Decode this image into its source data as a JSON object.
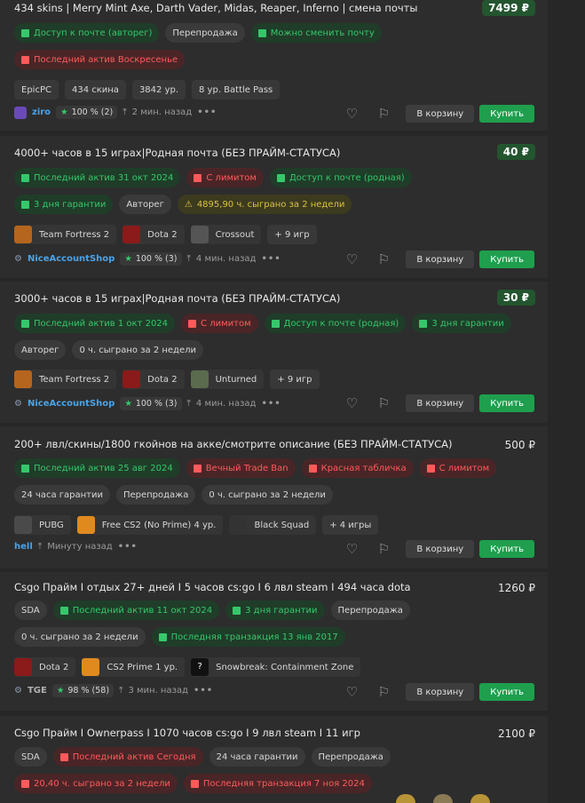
{
  "common": {
    "cart_label": "В корзину",
    "buy_label": "Купить",
    "heart_icon": "heart-icon",
    "flag_icon": "flag-icon"
  },
  "listings": [
    {
      "title": "434 skins | Merry Mint Axe, Darth Vader, Midas, Reaper, Inferno | смена почты",
      "price": "7499 ₽",
      "chips1": [
        {
          "text": "Доступ к почте (авторег)",
          "kind": "good"
        },
        {
          "text": "Перепродажа",
          "kind": "neutral"
        },
        {
          "text": "Можно сменить почту",
          "kind": "good"
        }
      ],
      "chips2": [
        {
          "text": "Последний актив Воскресенье",
          "kind": "bad"
        }
      ],
      "tags": [
        "EpicPC",
        "434 скина",
        "3842 ур.",
        "8 ур. Battle Pass"
      ],
      "seller": {
        "name": "ziro",
        "rating": "100 % (2)",
        "time": "2 мин. назад"
      }
    },
    {
      "title": "4000+ часов в 15 играх|Родная почта (БЕЗ ПРАЙМ-СТАТУСА)",
      "price": "40 ₽",
      "chips1": [
        {
          "text": "Последний актив 31 окт 2024",
          "kind": "good"
        },
        {
          "text": "С лимитом",
          "kind": "bad"
        },
        {
          "text": "Доступ к почте (родная)",
          "kind": "good"
        }
      ],
      "chips2": [
        {
          "text": "3 дня гарантии",
          "kind": "good"
        },
        {
          "text": "Авторег",
          "kind": "neutral"
        },
        {
          "text": "4895,90 ч. сыграно за 2 недели",
          "kind": "warn"
        }
      ],
      "games": [
        {
          "name": "Team Fortress 2",
          "color": "#b5651d"
        },
        {
          "name": "Dota 2",
          "color": "#8b1a1a"
        },
        {
          "name": "Crossout",
          "color": "#555555"
        }
      ],
      "more": "+ 9 игр",
      "seller": {
        "name": "NiceAccountShop",
        "rating": "100 % (3)",
        "time": "4 мин. назад"
      }
    },
    {
      "title": "3000+ часов в 15 играх|Родная почта (БЕЗ ПРАЙМ-СТАТУСА)",
      "price": "30 ₽",
      "chips1": [
        {
          "text": "Последний актив 1 окт 2024",
          "kind": "good"
        },
        {
          "text": "С лимитом",
          "kind": "bad"
        },
        {
          "text": "Доступ к почте (родная)",
          "kind": "good"
        },
        {
          "text": "3 дня гарантии",
          "kind": "good"
        }
      ],
      "chips2": [
        {
          "text": "Авторег",
          "kind": "neutral"
        },
        {
          "text": "0 ч. сыграно за 2 недели",
          "kind": "neutral"
        }
      ],
      "games": [
        {
          "name": "Team Fortress 2",
          "color": "#b5651d"
        },
        {
          "name": "Dota 2",
          "color": "#8b1a1a"
        },
        {
          "name": "Unturned",
          "color": "#5a6b4e"
        }
      ],
      "more": "+ 9 игр",
      "seller": {
        "name": "NiceAccountShop",
        "rating": "100 % (3)",
        "time": "4 мин. назад"
      }
    },
    {
      "title": "200+ лвл/скины/1800 гкойнов на акке/смотрите описание (БЕЗ ПРАЙМ-СТАТУСА)",
      "price": "500 ₽",
      "chips1": [
        {
          "text": "Последний актив 25 авг 2024",
          "kind": "good"
        },
        {
          "text": "Вечный Trade Ban",
          "kind": "bad"
        },
        {
          "text": "Красная табличка",
          "kind": "bad"
        },
        {
          "text": "С лимитом",
          "kind": "bad"
        }
      ],
      "chips2": [
        {
          "text": "24 часа гарантии",
          "kind": "neutral"
        },
        {
          "text": "Перепродажа",
          "kind": "neutral"
        },
        {
          "text": "0 ч. сыграно за 2 недели",
          "kind": "neutral"
        }
      ],
      "games": [
        {
          "name": "PUBG",
          "color": "#4a4a4a"
        },
        {
          "name": "Free CS2 (No Prime) 4 ур.",
          "color": "#e08a1e"
        },
        {
          "name": "Black Squad",
          "color": "#333333"
        }
      ],
      "more": "+ 4 игры",
      "seller": {
        "name": "hell",
        "rating": "",
        "time": "Минуту назад"
      }
    },
    {
      "title": "Csgo Прайм I отдых 27+ дней I 5 часов cs:go I 6 лвл steam I 494 часа dota",
      "price": "1260 ₽",
      "chips1": [
        {
          "text": "SDA",
          "kind": "neutral"
        },
        {
          "text": "Последний актив 11 окт 2024",
          "kind": "good"
        },
        {
          "text": "3 дня гарантии",
          "kind": "good"
        },
        {
          "text": "Перепродажа",
          "kind": "neutral"
        }
      ],
      "chips2": [
        {
          "text": "0 ч. сыграно за 2 недели",
          "kind": "neutral"
        },
        {
          "text": "Последняя транзакция 13 янв 2017",
          "kind": "good"
        }
      ],
      "games": [
        {
          "name": "Dota 2",
          "color": "#8b1a1a"
        },
        {
          "name": "CS2 Prime 1 ур.",
          "color": "#e08a1e"
        },
        {
          "name": "Snowbreak: Containment Zone",
          "color": "#111111"
        }
      ],
      "more": "",
      "seller": {
        "name": "TGE",
        "rating": "98 % (58)",
        "time": "3 мин. назад"
      }
    },
    {
      "title": "Csgo Прайм I Ownerpass I 1070 часов cs:go I 9 лвл steam I 11 игр",
      "price": "2100 ₽",
      "chips1": [
        {
          "text": "SDA",
          "kind": "neutral"
        },
        {
          "text": "Последний актив Сегодня",
          "kind": "bad"
        },
        {
          "text": "24 часа гарантии",
          "kind": "neutral"
        },
        {
          "text": "Перепродажа",
          "kind": "neutral"
        }
      ],
      "chips2": [
        {
          "text": "20,40 ч. сыграно за 2 недели",
          "kind": "bad"
        },
        {
          "text": "Последняя транзакция 7 ноя 2024",
          "kind": "bad"
        }
      ]
    }
  ]
}
